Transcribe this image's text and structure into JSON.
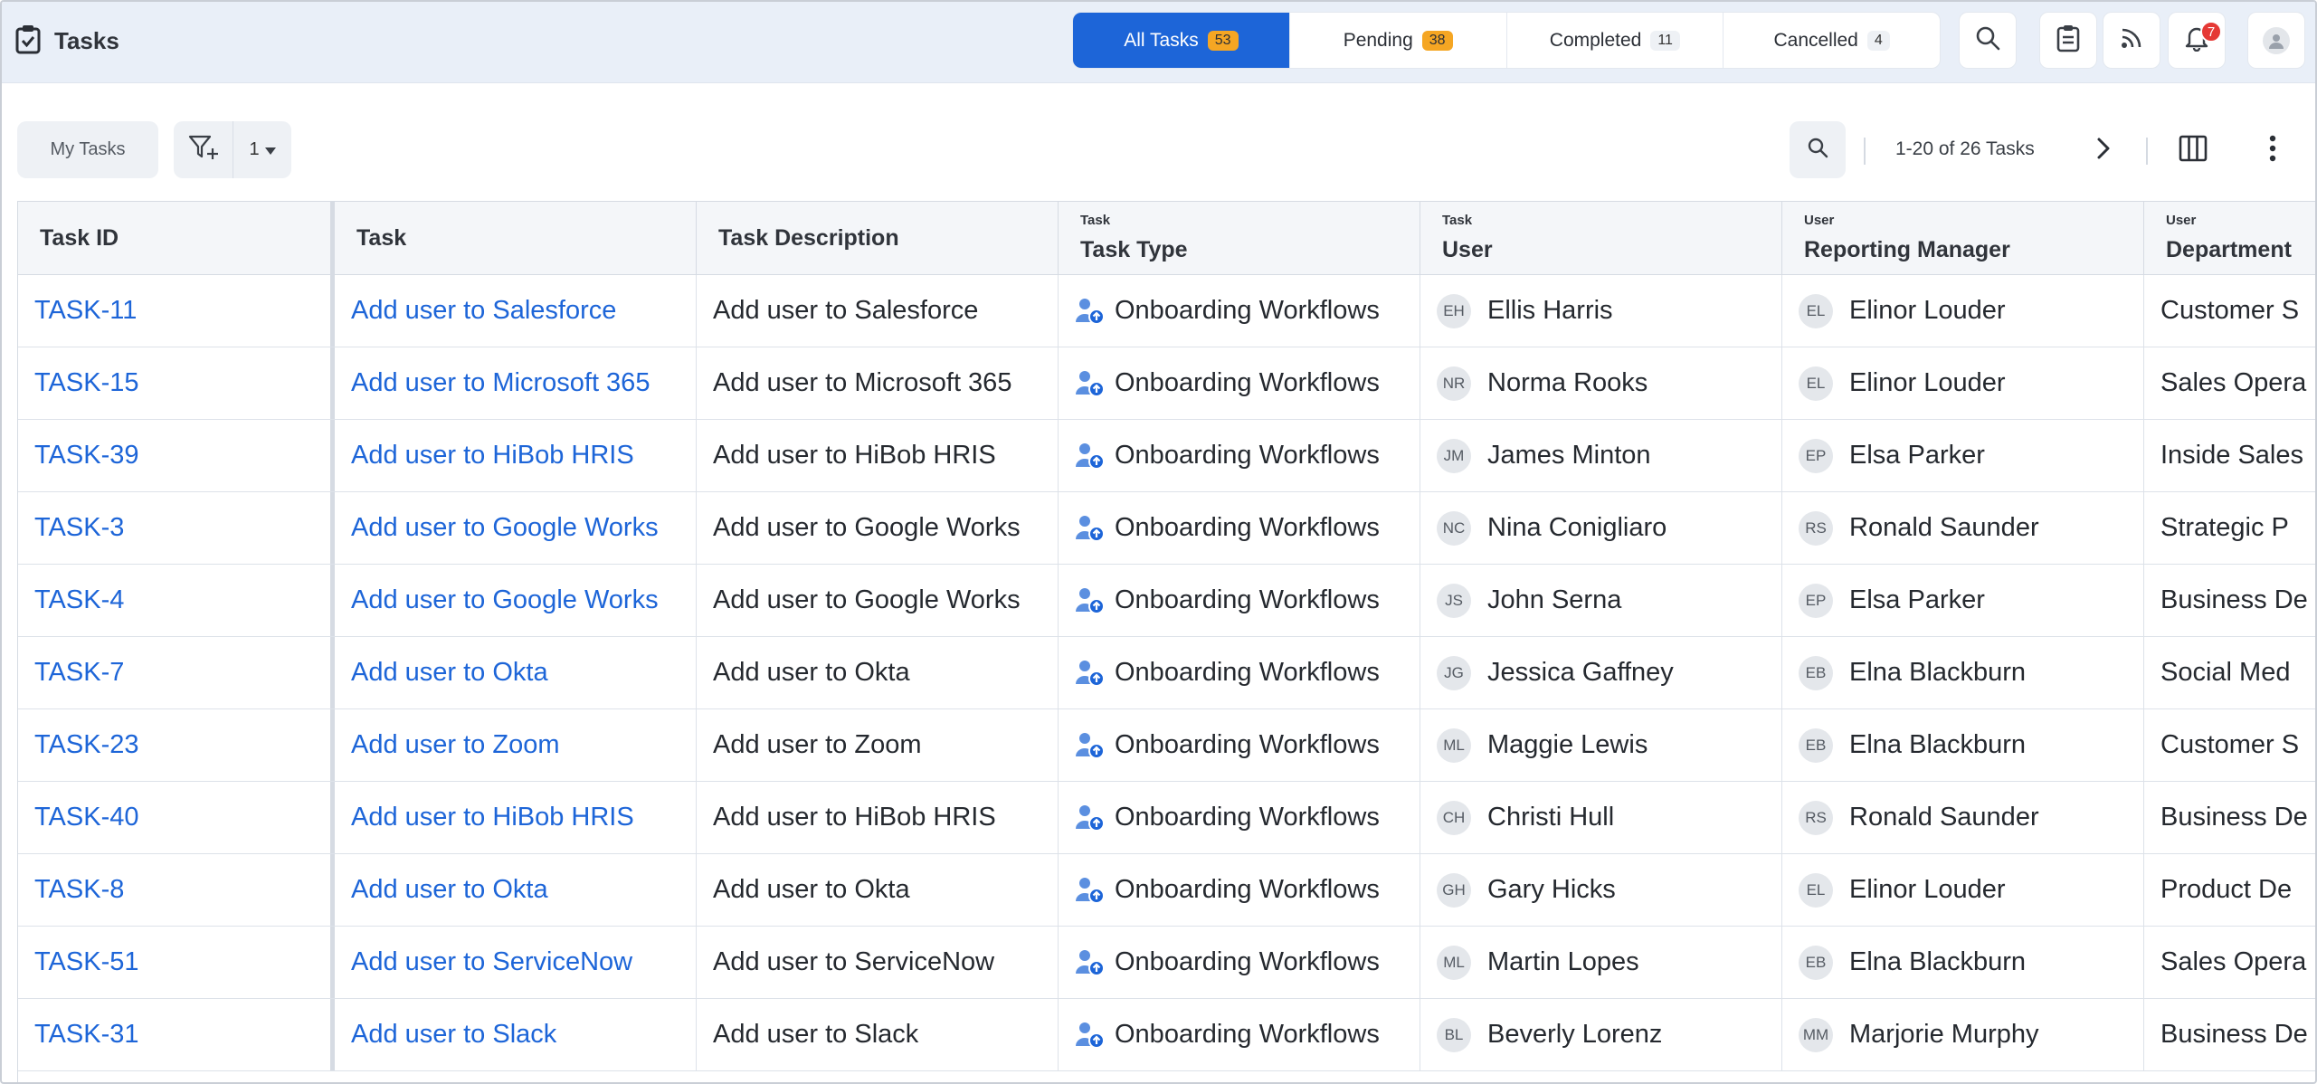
{
  "header": {
    "title": "Tasks",
    "title_icon": "clipboard-check-icon",
    "tabs": [
      {
        "label": "All Tasks",
        "count": "53",
        "active": true
      },
      {
        "label": "Pending",
        "count": "38",
        "active": false
      },
      {
        "label": "Completed",
        "count": "11",
        "active": false
      },
      {
        "label": "Cancelled",
        "count": "4",
        "active": false
      }
    ],
    "icons": [
      "search-icon",
      "clipboard-icon",
      "rss-icon",
      "bell-icon",
      "user-avatar-icon"
    ],
    "notification_count": "7",
    "accent_color": "#1d65d8",
    "badge_color": "#f5a623"
  },
  "toolbar": {
    "my_tasks_label": "My Tasks",
    "filter_count": "1",
    "paging_text": "1-20 of 26 Tasks"
  },
  "table": {
    "columns": [
      {
        "group": "",
        "label": "Task ID"
      },
      {
        "group": "",
        "label": "Task"
      },
      {
        "group": "",
        "label": "Task Description"
      },
      {
        "group": "Task",
        "label": "Task Type"
      },
      {
        "group": "Task",
        "label": "User"
      },
      {
        "group": "User",
        "label": "Reporting Manager"
      },
      {
        "group": "User",
        "label": "Department"
      }
    ],
    "rows": [
      {
        "id": "TASK-11",
        "task": "Add user to Salesforce",
        "desc": "Add user to Salesforce",
        "type": "Onboarding Workflows",
        "user_ini": "EH",
        "user": "Ellis Harris",
        "mgr_ini": "EL",
        "mgr": "Elinor Louder",
        "dept": "Customer S"
      },
      {
        "id": "TASK-15",
        "task": "Add user to Microsoft 365",
        "desc": "Add user to Microsoft 365",
        "type": "Onboarding Workflows",
        "user_ini": "NR",
        "user": "Norma Rooks",
        "mgr_ini": "EL",
        "mgr": "Elinor Louder",
        "dept": "Sales Opera"
      },
      {
        "id": "TASK-39",
        "task": "Add user to HiBob HRIS",
        "desc": "Add user to HiBob HRIS",
        "type": "Onboarding Workflows",
        "user_ini": "JM",
        "user": "James Minton",
        "mgr_ini": "EP",
        "mgr": "Elsa Parker",
        "dept": "Inside Sales"
      },
      {
        "id": "TASK-3",
        "task": "Add user to Google Works",
        "desc": "Add user to Google Works",
        "type": "Onboarding Workflows",
        "user_ini": "NC",
        "user": "Nina Conigliaro",
        "mgr_ini": "RS",
        "mgr": "Ronald Saunder",
        "dept": "Strategic P"
      },
      {
        "id": "TASK-4",
        "task": "Add user to Google Works",
        "desc": "Add user to Google Works",
        "type": "Onboarding Workflows",
        "user_ini": "JS",
        "user": "John Serna",
        "mgr_ini": "EP",
        "mgr": "Elsa Parker",
        "dept": "Business De"
      },
      {
        "id": "TASK-7",
        "task": "Add user to Okta",
        "desc": "Add user to Okta",
        "type": "Onboarding Workflows",
        "user_ini": "JG",
        "user": "Jessica Gaffney",
        "mgr_ini": "EB",
        "mgr": "Elna Blackburn",
        "dept": "Social Med"
      },
      {
        "id": "TASK-23",
        "task": "Add user to Zoom",
        "desc": "Add user to Zoom",
        "type": "Onboarding Workflows",
        "user_ini": "ML",
        "user": "Maggie Lewis",
        "mgr_ini": "EB",
        "mgr": "Elna Blackburn",
        "dept": "Customer S"
      },
      {
        "id": "TASK-40",
        "task": "Add user to HiBob HRIS",
        "desc": "Add user to HiBob HRIS",
        "type": "Onboarding Workflows",
        "user_ini": "CH",
        "user": "Christi Hull",
        "mgr_ini": "RS",
        "mgr": "Ronald Saunder",
        "dept": "Business De"
      },
      {
        "id": "TASK-8",
        "task": "Add user to Okta",
        "desc": "Add user to Okta",
        "type": "Onboarding Workflows",
        "user_ini": "GH",
        "user": "Gary Hicks",
        "mgr_ini": "EL",
        "mgr": "Elinor Louder",
        "dept": "Product De"
      },
      {
        "id": "TASK-51",
        "task": "Add user to ServiceNow",
        "desc": "Add user to ServiceNow",
        "type": "Onboarding Workflows",
        "user_ini": "ML",
        "user": "Martin Lopes",
        "mgr_ini": "EB",
        "mgr": "Elna Blackburn",
        "dept": "Sales Opera"
      },
      {
        "id": "TASK-31",
        "task": "Add user to Slack",
        "desc": "Add user to Slack",
        "type": "Onboarding Workflows",
        "user_ini": "BL",
        "user": "Beverly Lorenz",
        "mgr_ini": "MM",
        "mgr": "Marjorie Murphy",
        "dept": "Business De"
      }
    ]
  }
}
